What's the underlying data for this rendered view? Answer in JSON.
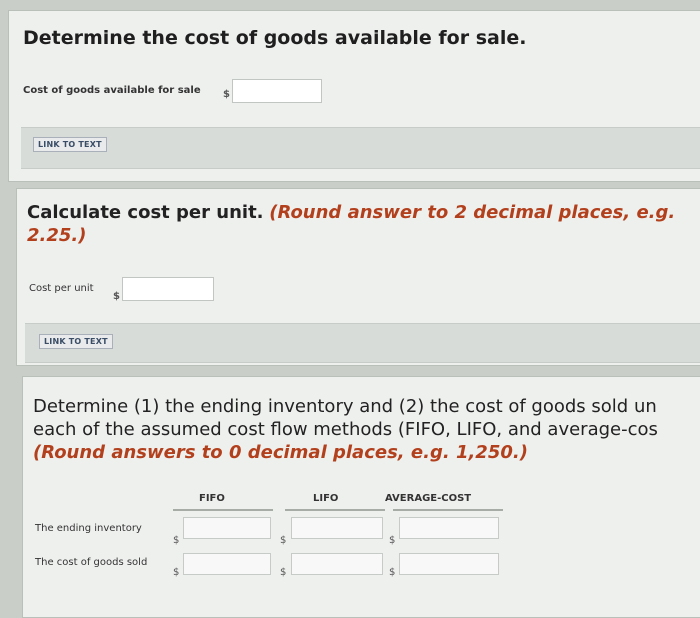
{
  "q1": {
    "title": "Determine the cost of goods available for sale.",
    "field_label": "Cost of goods available for sale",
    "currency": "$",
    "value": "",
    "link": "LINK TO TEXT"
  },
  "q2": {
    "text_plain": "Calculate cost per unit.",
    "text_red": "(Round answer to 2 decimal places, e.g. 2.25.)",
    "field_label": "Cost per unit",
    "currency": "$",
    "value": "",
    "link": "LINK TO TEXT"
  },
  "q3": {
    "line1": "Determine (1) the ending inventory and (2) the cost of goods sold un",
    "line2": "each of the assumed cost flow methods (FIFO, LIFO, and average-cos",
    "line3_red": "(Round answers to 0 decimal places, e.g. 1,250.)",
    "columns": [
      "FIFO",
      "LIFO",
      "AVERAGE-COST"
    ],
    "rows": [
      {
        "label": "The ending inventory",
        "currency": [
          "$",
          "$",
          "$"
        ],
        "values": [
          "",
          "",
          ""
        ]
      },
      {
        "label": "The cost of goods sold",
        "currency": [
          "$",
          "$",
          "$"
        ],
        "values": [
          "",
          "",
          ""
        ]
      }
    ]
  }
}
